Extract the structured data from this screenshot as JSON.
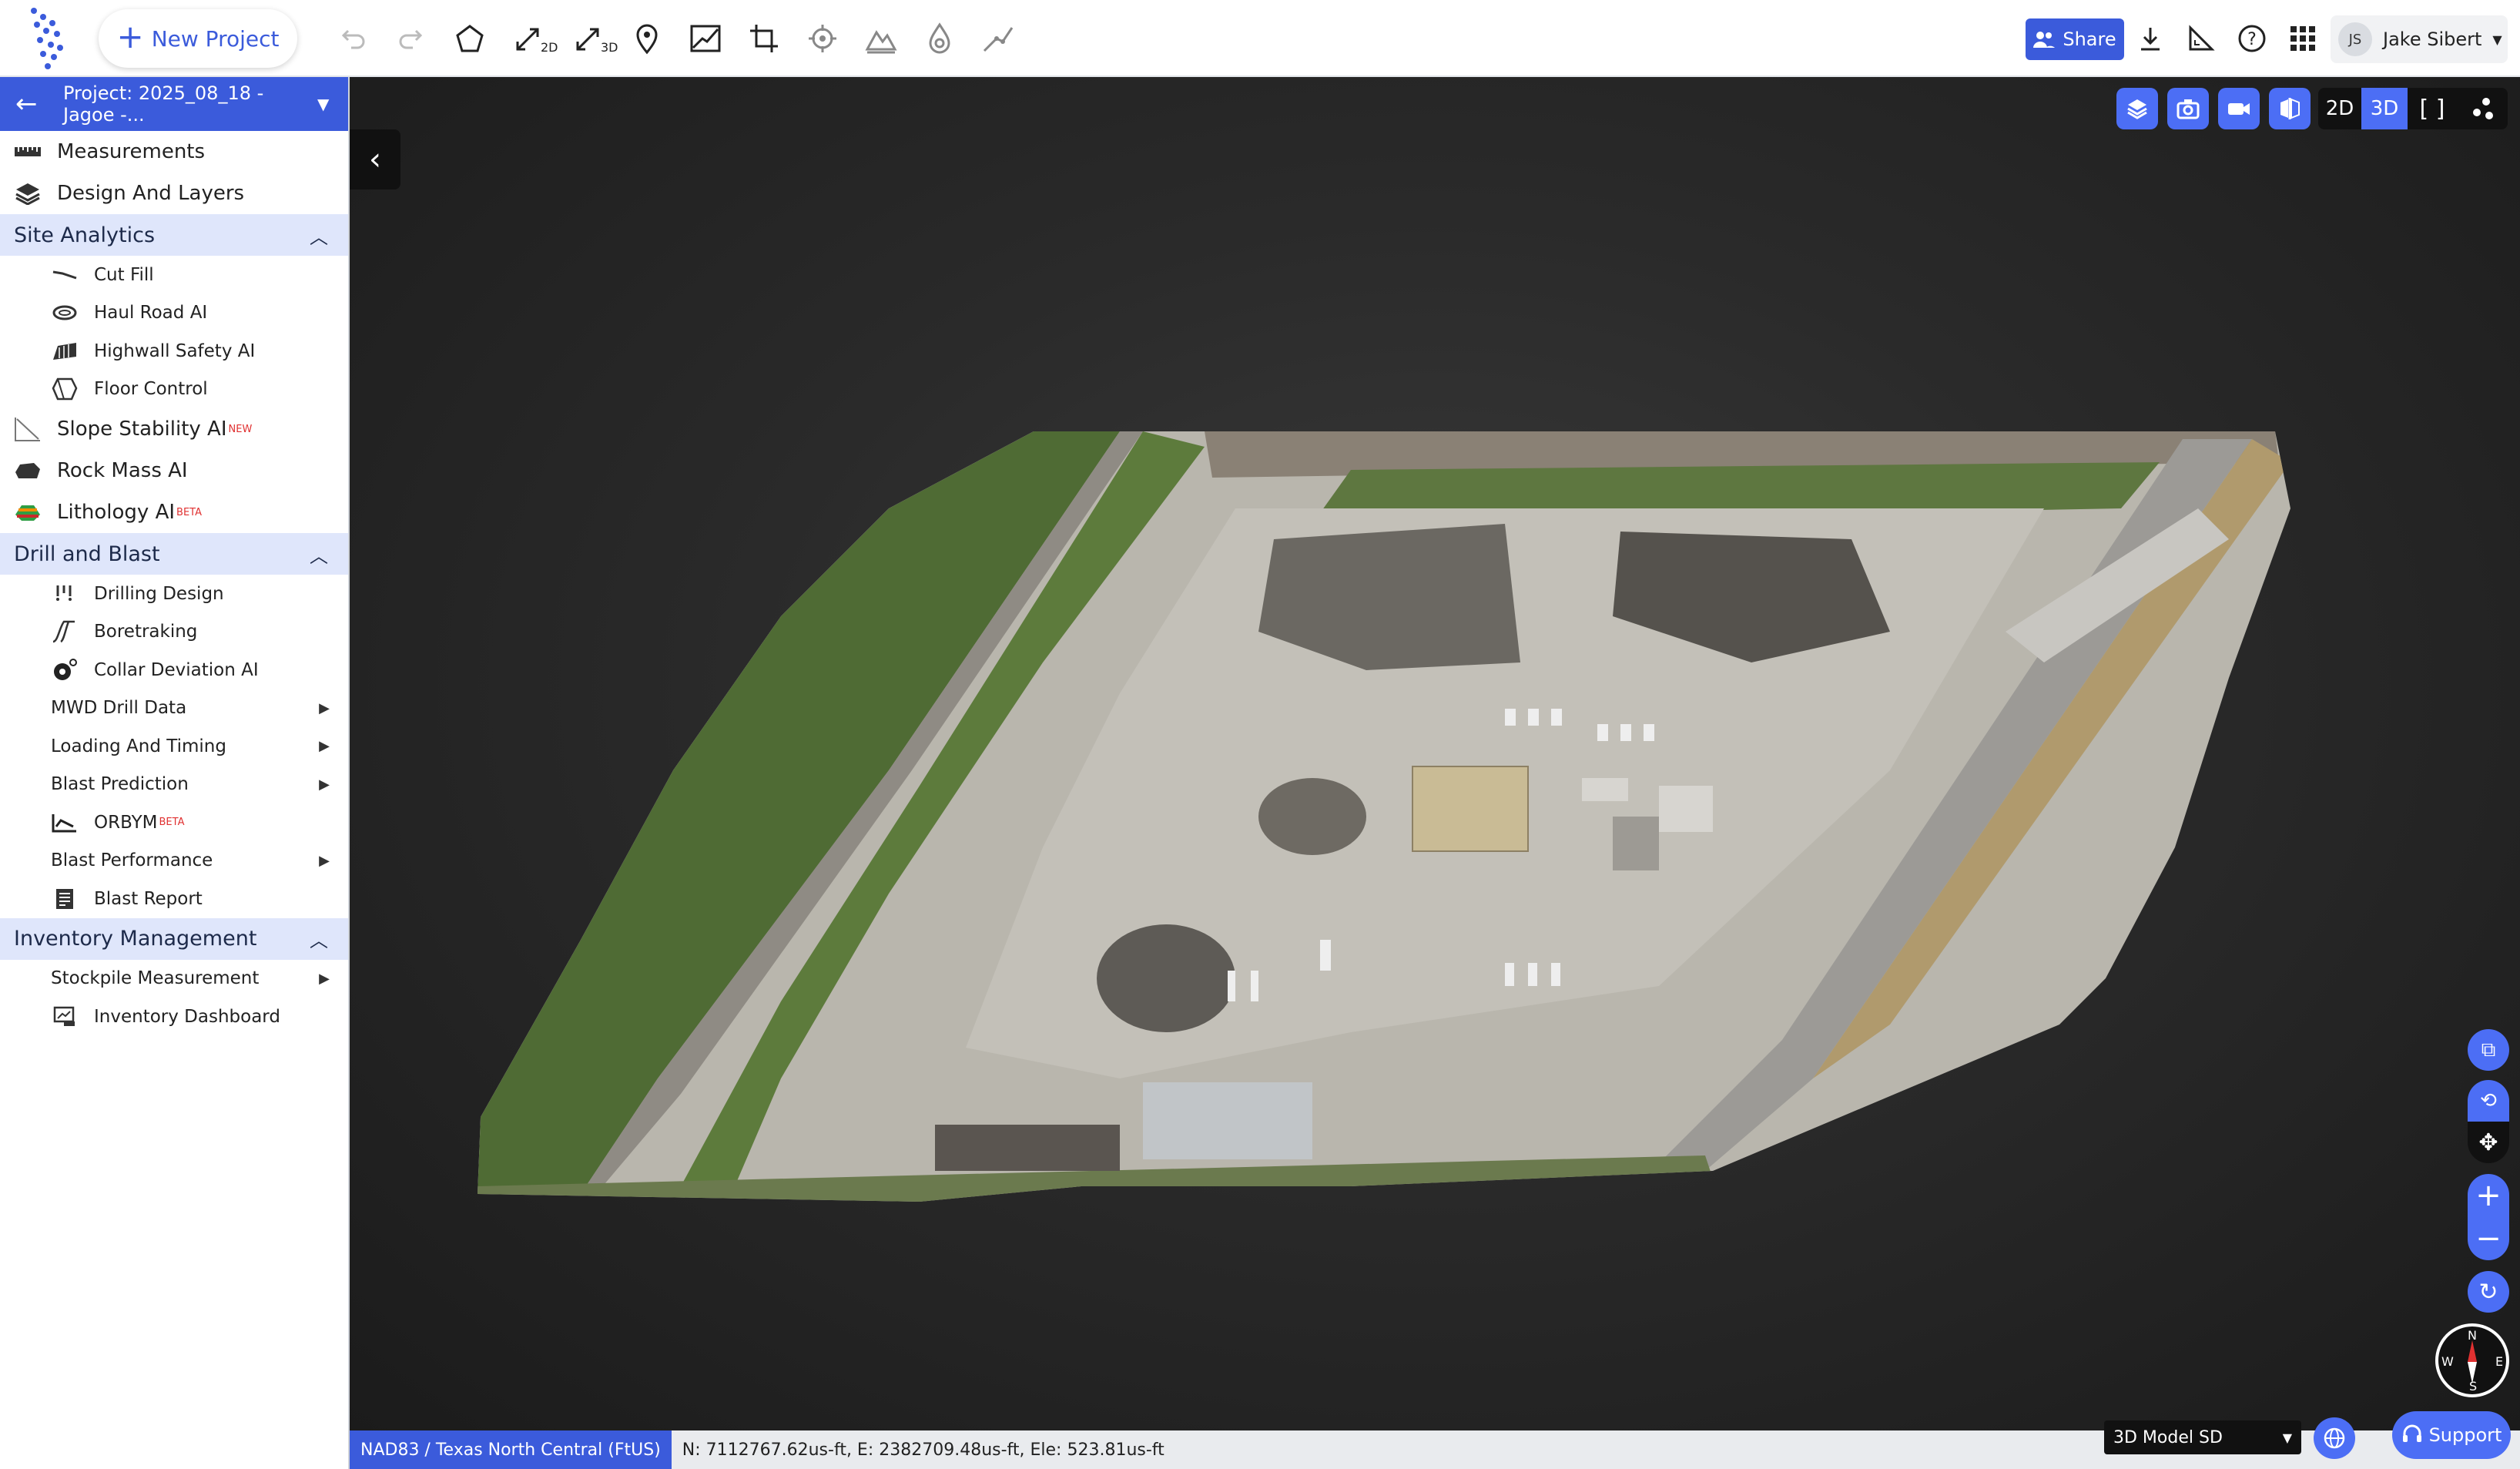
{
  "toolbar": {
    "new_project_label": "New Project",
    "share_label": "Share",
    "user_initials": "JS",
    "user_name": "Jake Sibert",
    "tools": [
      "undo-icon",
      "redo-icon",
      "polygon-icon",
      "measure-2d-icon",
      "measure-3d-icon",
      "location-pin-icon",
      "profile-icon",
      "crop-icon",
      "target-icon",
      "terrain-icon",
      "water-drop-icon",
      "slope-icon"
    ],
    "tool_sublabels": {
      "measure_2d": "2D",
      "measure_3d": "3D"
    }
  },
  "sidebar": {
    "project_label": "Project: 2025_08_18 - Jagoe -...",
    "top_items": [
      {
        "label": "Measurements",
        "icon": "ruler-icon"
      },
      {
        "label": "Design And Layers",
        "icon": "layers-icon"
      }
    ],
    "site_analytics": {
      "title": "Site Analytics",
      "items": [
        {
          "label": "Cut Fill",
          "icon": "cut-fill-icon"
        },
        {
          "label": "Haul Road AI",
          "icon": "haul-road-icon"
        },
        {
          "label": "Highwall Safety AI",
          "icon": "highwall-icon"
        },
        {
          "label": "Floor Control",
          "icon": "floor-control-icon"
        }
      ]
    },
    "slope_stability": {
      "label": "Slope Stability AI",
      "badge": "NEW"
    },
    "rock_mass": {
      "label": "Rock Mass AI"
    },
    "lithology": {
      "label": "Lithology AI",
      "badge": "BETA"
    },
    "drill_blast": {
      "title": "Drill and Blast",
      "drilling_design": "Drilling Design",
      "boretraking": "Boretraking",
      "collar_deviation": "Collar Deviation AI",
      "mwd": "MWD Drill Data",
      "loading_timing": "Loading And Timing",
      "blast_prediction": "Blast Prediction",
      "orbym": "ORBYM",
      "orbym_badge": "BETA",
      "blast_performance": "Blast Performance",
      "blast_report": "Blast Report"
    },
    "inventory": {
      "title": "Inventory Management",
      "stockpile": "Stockpile Measurement",
      "dashboard": "Inventory Dashboard"
    }
  },
  "viewer": {
    "mode_2d": "2D",
    "mode_3d": "3D",
    "active_mode": "3D",
    "compass": {
      "n": "N",
      "s": "S",
      "e": "E",
      "w": "W"
    }
  },
  "status": {
    "crs": "NAD83 / Texas North Central (FtUS)",
    "coords": "N: 7112767.62us-ft, E: 2382709.48us-ft, Ele: 523.81us-ft",
    "model_select": "3D Model SD",
    "support_label": "Support"
  },
  "colors": {
    "accent": "#3b5bdb",
    "accent_light": "#4c6ef5",
    "section_bg": "#dfe6fb",
    "badge": "#e03131"
  }
}
